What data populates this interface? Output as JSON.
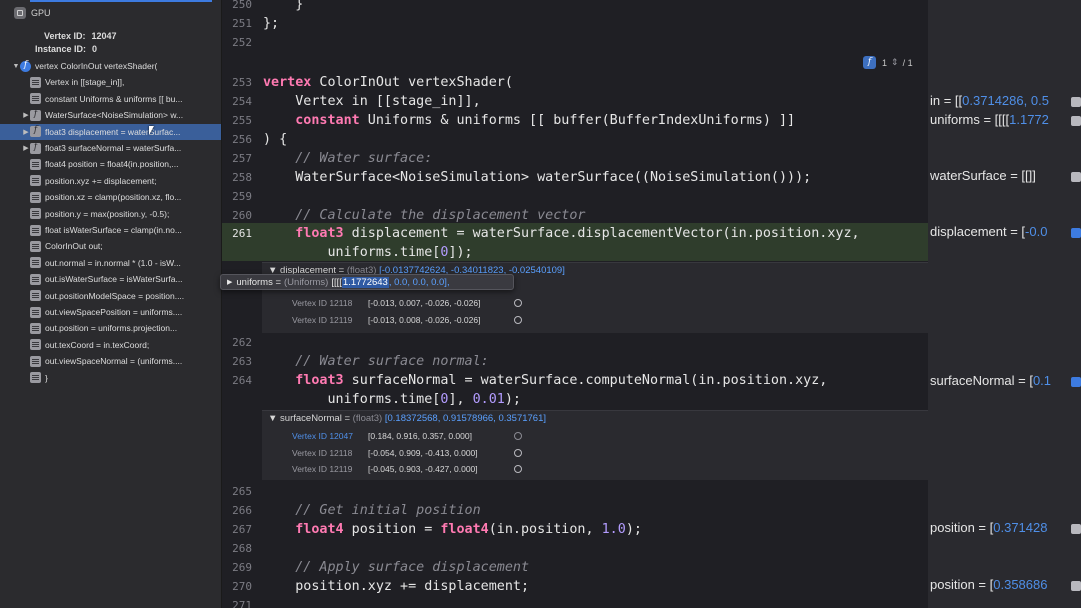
{
  "sidebar": {
    "gpu_label": "GPU",
    "vertex_id_key": "Vertex ID:",
    "vertex_id_value": "12047",
    "instance_id_key": "Instance ID:",
    "instance_id_value": "0",
    "items": [
      {
        "label": "vertex ColorInOut vertexShader(",
        "icon": "function-icon",
        "disclosure": "▼"
      },
      {
        "label": "Vertex in [[stage_in]],",
        "icon": "lines-icon",
        "disclosure": ""
      },
      {
        "label": "constant Uniforms & uniforms [[ bu...",
        "icon": "lines-icon",
        "disclosure": ""
      },
      {
        "label": "WaterSurface<NoiseSimulation> w...",
        "icon": "function-icon",
        "disclosure": "▶"
      },
      {
        "label": "float3 displacement = waterSurfac...",
        "icon": "function-icon",
        "disclosure": "▶"
      },
      {
        "label": "float3 surfaceNormal = waterSurfa...",
        "icon": "function-icon",
        "disclosure": "▶"
      },
      {
        "label": "float4 position = float4(in.position,...",
        "icon": "lines-icon",
        "disclosure": ""
      },
      {
        "label": "position.xyz += displacement;",
        "icon": "lines-icon",
        "disclosure": ""
      },
      {
        "label": "position.xz = clamp(position.xz, flo...",
        "icon": "lines-icon",
        "disclosure": ""
      },
      {
        "label": "position.y = max(position.y, -0.5);",
        "icon": "lines-icon",
        "disclosure": ""
      },
      {
        "label": "float isWaterSurface = clamp(in.no...",
        "icon": "lines-icon",
        "disclosure": ""
      },
      {
        "label": "ColorInOut out;",
        "icon": "lines-icon",
        "disclosure": ""
      },
      {
        "label": "out.normal = in.normal * (1.0 - isW...",
        "icon": "lines-icon",
        "disclosure": ""
      },
      {
        "label": "out.isWaterSurface = isWaterSurfa...",
        "icon": "lines-icon",
        "disclosure": ""
      },
      {
        "label": "out.positionModelSpace = position....",
        "icon": "lines-icon",
        "disclosure": ""
      },
      {
        "label": "out.viewSpacePosition = uniforms....",
        "icon": "lines-icon",
        "disclosure": ""
      },
      {
        "label": "out.position = uniforms.projection...",
        "icon": "lines-icon",
        "disclosure": ""
      },
      {
        "label": "out.texCoord = in.texCoord;",
        "icon": "lines-icon",
        "disclosure": ""
      },
      {
        "label": "out.viewSpaceNormal = (uniforms....",
        "icon": "lines-icon",
        "disclosure": ""
      },
      {
        "label": "}",
        "icon": "lines-icon",
        "disclosure": ""
      }
    ]
  },
  "editor": {
    "scope_badge": {
      "icon": "function-icon",
      "index": "1",
      "total": "/ 1"
    },
    "lines": [
      {
        "n": "250",
        "text": "    }"
      },
      {
        "n": "251",
        "text": "};"
      },
      {
        "n": "252",
        "text": ""
      },
      {
        "n": "253",
        "text": "vertex ColorInOut vertexShader("
      },
      {
        "n": "254",
        "text": "    Vertex in [[stage_in]],"
      },
      {
        "n": "255",
        "text": "    constant Uniforms & uniforms [[ buffer(BufferIndexUniforms) ]]"
      },
      {
        "n": "256",
        "text": ") {"
      },
      {
        "n": "257",
        "text": "    // Water surface:"
      },
      {
        "n": "258",
        "text": "    WaterSurface<NoiseSimulation> waterSurface((NoiseSimulation()));"
      },
      {
        "n": "259",
        "text": ""
      },
      {
        "n": "260",
        "text": "    // Calculate the displacement vector"
      },
      {
        "n": "261",
        "text": "    float3 displacement = waterSurface.displacementVector(in.position.xyz,"
      },
      {
        "n": "",
        "text": "        uniforms.time[0]);"
      },
      {
        "n": "262",
        "text": ""
      },
      {
        "n": "263",
        "text": "    // Water surface normal:"
      },
      {
        "n": "264",
        "text": "    float3 surfaceNormal = waterSurface.computeNormal(in.position.xyz,"
      },
      {
        "n": "",
        "text": "        uniforms.time[0], 0.01);"
      },
      {
        "n": "265",
        "text": ""
      },
      {
        "n": "266",
        "text": "    // Get initial position"
      },
      {
        "n": "267",
        "text": "    float4 position = float4(in.position, 1.0);"
      },
      {
        "n": "268",
        "text": ""
      },
      {
        "n": "269",
        "text": "    // Apply surface displacement"
      },
      {
        "n": "270",
        "text": "    position.xyz += displacement;"
      },
      {
        "n": "271",
        "text": ""
      }
    ],
    "displacement_panel": {
      "head_name": "displacement =",
      "head_type": "(float3)",
      "head_values": "[-0.0137742624, -0.34011823, -0.02540109]",
      "rows": [
        {
          "vid": "Vertex ID 12118",
          "val": "[-0.013, 0.007, -0.026, -0.026]"
        },
        {
          "vid": "Vertex ID 12119",
          "val": "[-0.013, 0.008, -0.026, -0.026]"
        }
      ]
    },
    "uniforms_tooltip": {
      "name": "uniforms =",
      "type": "(Uniforms)",
      "prefix": "[[[[",
      "value_selected": "1.1772643",
      "rest": ", 0.0, 0.0, 0.0],"
    },
    "normal_panel": {
      "head_name": "surfaceNormal =",
      "head_type": "(float3)",
      "head_values": "[0.18372568, 0.91578966, 0.3571761]",
      "rows": [
        {
          "vid": "Vertex ID 12047",
          "val": "[0.184, 0.916, 0.357, 0.000]",
          "current": true
        },
        {
          "vid": "Vertex ID 12118",
          "val": "[-0.054, 0.909, -0.413, 0.000]",
          "current": false
        },
        {
          "vid": "Vertex ID 12119",
          "val": "[-0.045, 0.903, -0.427, 0.000]",
          "current": false
        }
      ]
    }
  },
  "results": [
    {
      "name": "in = [[",
      "value": "0.3714286, 0.5",
      "btn": "gray"
    },
    {
      "name": "uniforms = [[[[",
      "value": "1.1772",
      "btn": "gray"
    },
    {
      "name": "waterSurface = [[]]",
      "value": "",
      "btn": "gray"
    },
    {
      "name": "displacement = [",
      "value": "-0.0",
      "btn": "blue"
    },
    {
      "name": "surfaceNormal = [",
      "value": "0.1",
      "btn": "blue"
    },
    {
      "name": "position = [",
      "value": "0.371428",
      "btn": "gray"
    },
    {
      "name": "position = [",
      "value": "0.358686",
      "btn": "gray"
    }
  ],
  "colors": {
    "accent": "#3d7be0",
    "keyword": "#ff7ab2",
    "comment": "#8a8a92",
    "number": "#b39cff",
    "highlight_line": "#2f3d2c"
  }
}
